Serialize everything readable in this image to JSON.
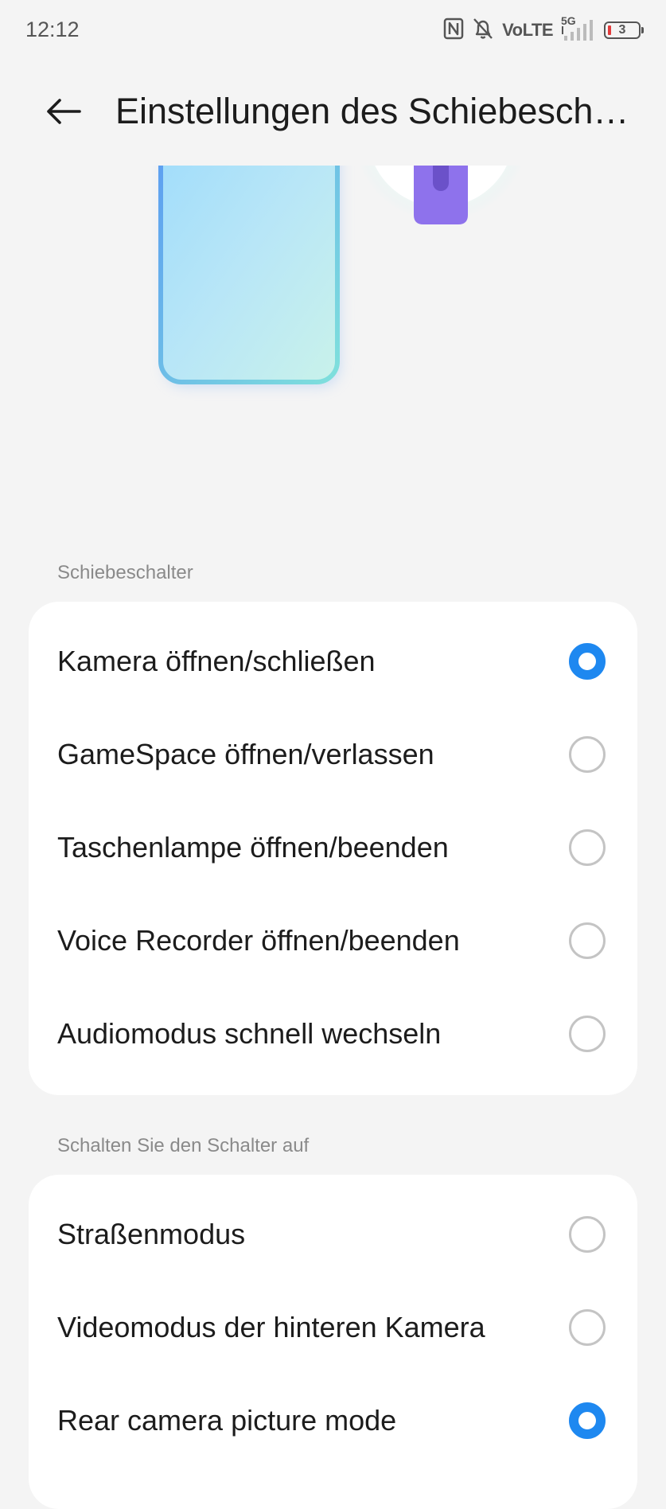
{
  "status_bar": {
    "time": "12:12",
    "network_label": "VoLTE",
    "signal_type": "5G",
    "battery_level": "3",
    "icons": [
      "nfc-icon",
      "bell-off-icon",
      "signal-icon",
      "battery-icon"
    ]
  },
  "header": {
    "title": "Einstellungen des Schiebeschalters",
    "back_icon": "back-arrow-icon"
  },
  "sections": [
    {
      "label": "Schiebeschalter",
      "options": [
        {
          "label": "Kamera öffnen/schließen",
          "selected": true
        },
        {
          "label": "GameSpace öffnen/verlassen",
          "selected": false
        },
        {
          "label": "Taschenlampe öffnen/beenden",
          "selected": false
        },
        {
          "label": "Voice Recorder öffnen/beenden",
          "selected": false
        },
        {
          "label": "Audiomodus schnell wechseln",
          "selected": false
        }
      ]
    },
    {
      "label": "Schalten Sie den Schalter auf",
      "options": [
        {
          "label": "Straßenmodus",
          "selected": false
        },
        {
          "label": "Videomodus der hinteren Kamera",
          "selected": false
        },
        {
          "label": "Rear camera picture mode",
          "selected": true
        }
      ]
    }
  ],
  "colors": {
    "accent": "#1e88f0",
    "background": "#f4f4f4",
    "card": "#ffffff",
    "section_label": "#8a8a8a"
  }
}
